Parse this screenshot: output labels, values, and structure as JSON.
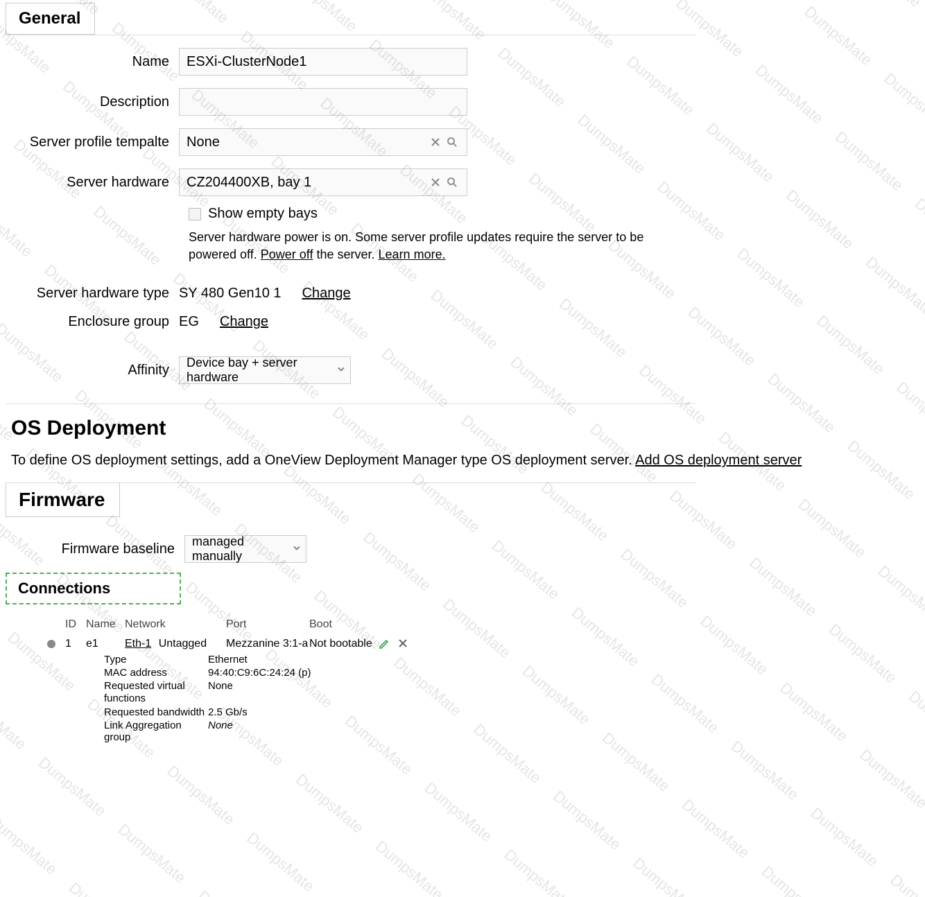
{
  "watermark_text": "DumpsMate",
  "general": {
    "heading": "General",
    "name_label": "Name",
    "name_value": "ESXi-ClusterNode1",
    "description_label": "Description",
    "description_value": "",
    "spt_label": "Server profile tempalte",
    "spt_value": "None",
    "hw_label": "Server hardware",
    "hw_value": "CZ204400XB, bay 1",
    "show_empty_label": "Show empty bays",
    "power_note_a": "Server hardware power is on. Some server profile updates require the server to be powered off. ",
    "power_off_link": "Power off",
    "power_note_b": " the server. ",
    "learn_more_link": "Learn more.",
    "hw_type_label": "Server hardware type",
    "hw_type_value": "SY 480 Gen10 1",
    "change_link": "Change",
    "eg_label": "Enclosure group",
    "eg_value": "EG",
    "affinity_label": "Affinity",
    "affinity_value": "Device bay + server hardware"
  },
  "os": {
    "heading": "OS Deployment",
    "text": "To define OS deployment settings, add a OneView Deployment Manager type OS deployment server. ",
    "link": "Add OS deployment server"
  },
  "firmware": {
    "heading": "Firmware",
    "baseline_label": "Firmware baseline",
    "baseline_value": "managed manually"
  },
  "connections": {
    "heading": "Connections",
    "cols": {
      "id": "ID",
      "name": "Name",
      "network": "Network",
      "port": "Port",
      "boot": "Boot"
    },
    "rows": [
      {
        "id": "1",
        "name": "e1",
        "network_name": "Eth-1",
        "network_tag": "Untagged",
        "port": "Mezzanine 3:1-a",
        "boot": "Not bootable"
      }
    ],
    "details": {
      "type_label": "Type",
      "type_value": "Ethernet",
      "mac_label": "MAC address",
      "mac_value": "94:40:C9:6C:24:24",
      "mac_suffix": "(p)",
      "rvf_label_a": "Requested virtual",
      "rvf_label_b": "functions",
      "rvf_value": "None",
      "bw_label": "Requested bandwidth",
      "bw_value": "2.5 Gb/s",
      "lag_label": "Link Aggregation group",
      "lag_value": "None"
    }
  }
}
